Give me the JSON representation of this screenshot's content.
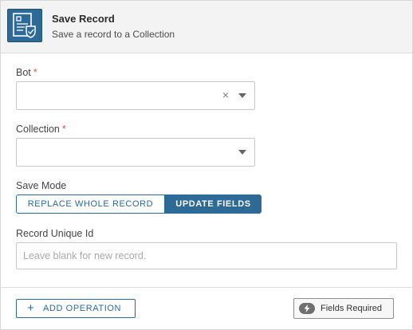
{
  "header": {
    "title": "Save Record",
    "subtitle": "Save a record to a Collection",
    "icon": "document-save-icon"
  },
  "form": {
    "bot": {
      "label": "Bot",
      "required_mark": "*",
      "value": "",
      "clear_glyph": "×"
    },
    "collection": {
      "label": "Collection",
      "required_mark": "*",
      "value": ""
    },
    "save_mode": {
      "label": "Save Mode",
      "options": [
        "REPLACE WHOLE RECORD",
        "UPDATE FIELDS"
      ],
      "selected": "UPDATE FIELDS"
    },
    "record_unique_id": {
      "label": "Record Unique Id",
      "value": "",
      "placeholder": "Leave blank for new record."
    }
  },
  "footer": {
    "add_operation_label": "ADD OPERATION",
    "add_operation_icon": "plus-icon",
    "fields_required_label": "Fields Required",
    "fields_required_icon": "lightning-icon"
  },
  "colors": {
    "accent": "#2d6a96",
    "required": "#d9534f"
  }
}
